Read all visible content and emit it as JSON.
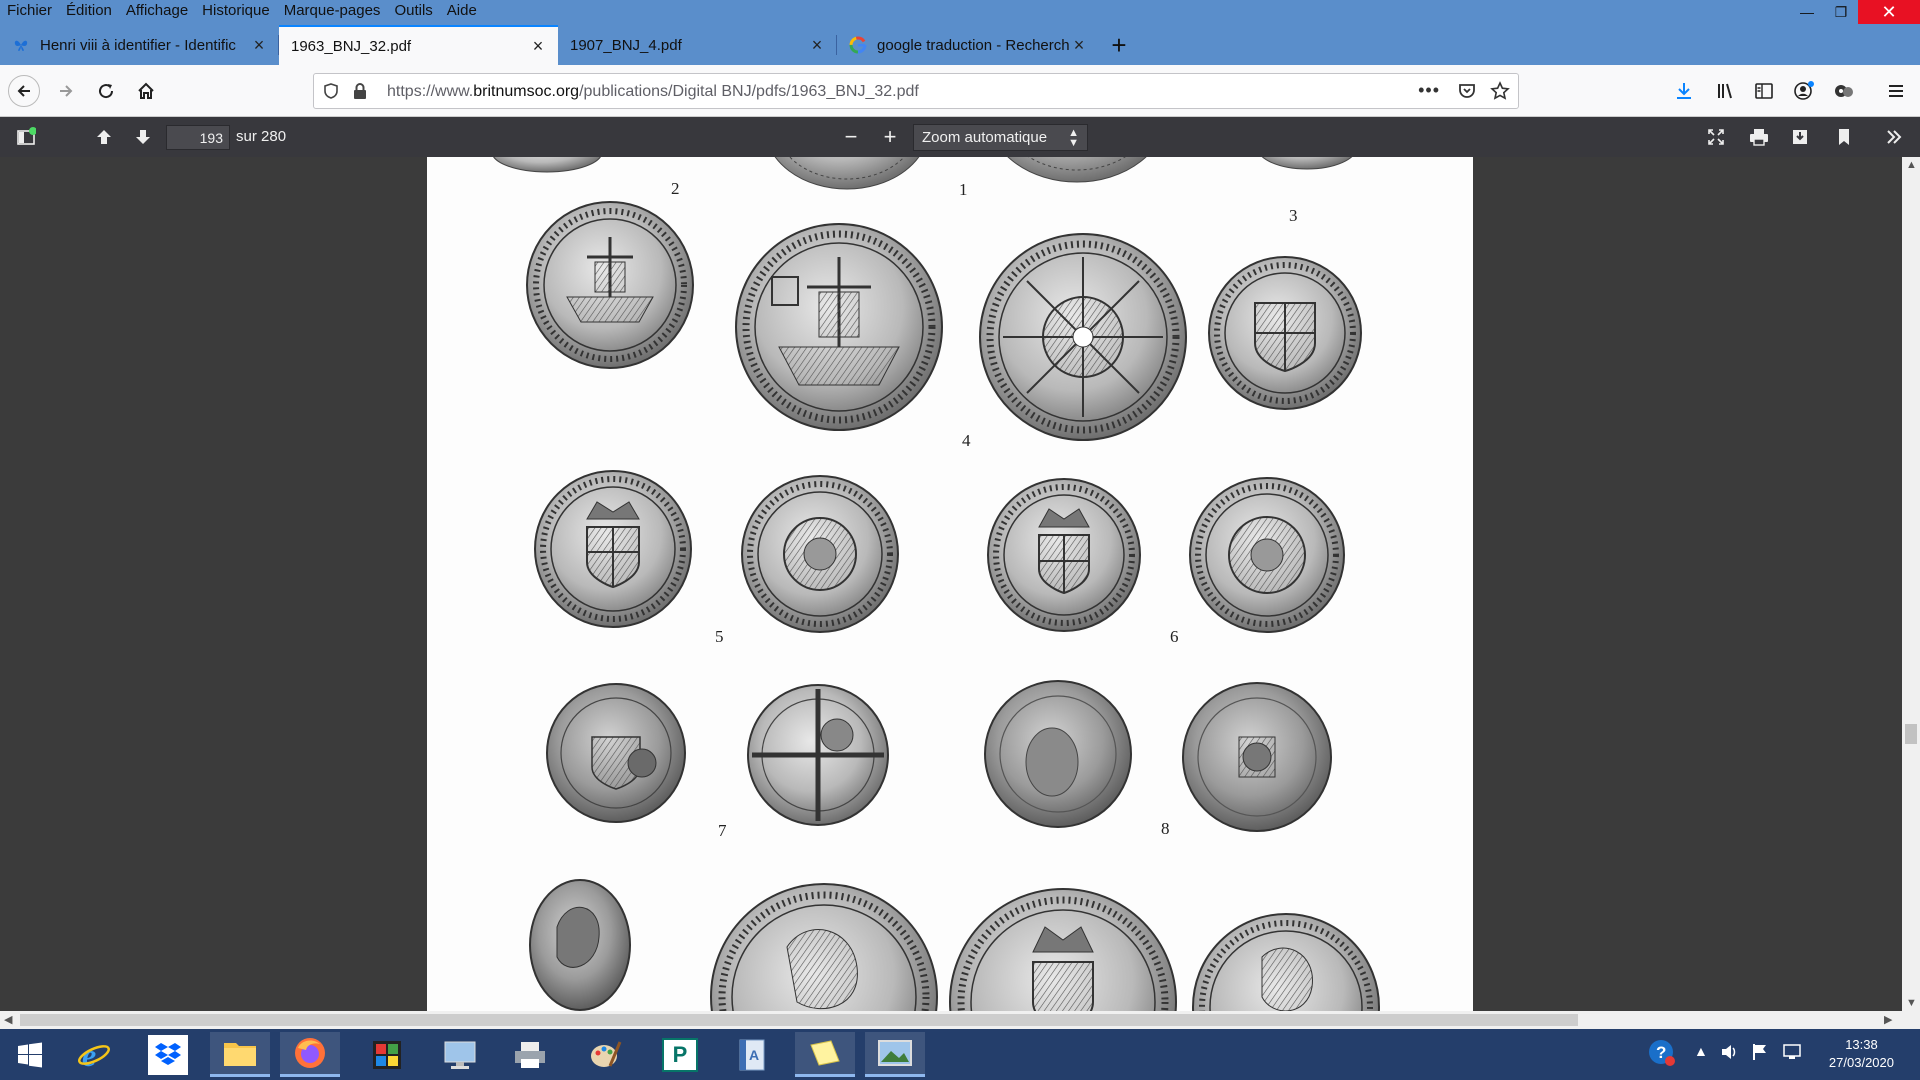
{
  "menubar": {
    "items": [
      "Fichier",
      "Édition",
      "Affichage",
      "Historique",
      "Marque-pages",
      "Outils",
      "Aide"
    ]
  },
  "tabs": [
    {
      "label": "Henri viii à identifier - Identific",
      "icon": "butterfly-icon",
      "active": false
    },
    {
      "label": "1963_BNJ_32.pdf",
      "icon": "",
      "active": true
    },
    {
      "label": "1907_BNJ_4.pdf",
      "icon": "",
      "active": false
    },
    {
      "label": "google traduction - Recherche",
      "icon": "google-icon",
      "active": false
    }
  ],
  "navbar": {
    "url_prefix": "https://www.",
    "url_domain": "britnumsoc.org",
    "url_path": "/publications/Digital BNJ/pdfs/1963_BNJ_32.pdf"
  },
  "pdf_toolbar": {
    "page_number": "193",
    "page_count": "sur 280",
    "zoom": "Zoom automatique"
  },
  "plate": {
    "labels": [
      "2",
      "1",
      "3",
      "4",
      "5",
      "6",
      "7",
      "8"
    ]
  },
  "taskbar": {
    "time": "13:38",
    "date": "27/03/2020"
  },
  "colors": {
    "titlebar": "#5a8ecb",
    "accent": "#0a84ff",
    "taskbar": "#243e6b",
    "close": "#e81123"
  }
}
